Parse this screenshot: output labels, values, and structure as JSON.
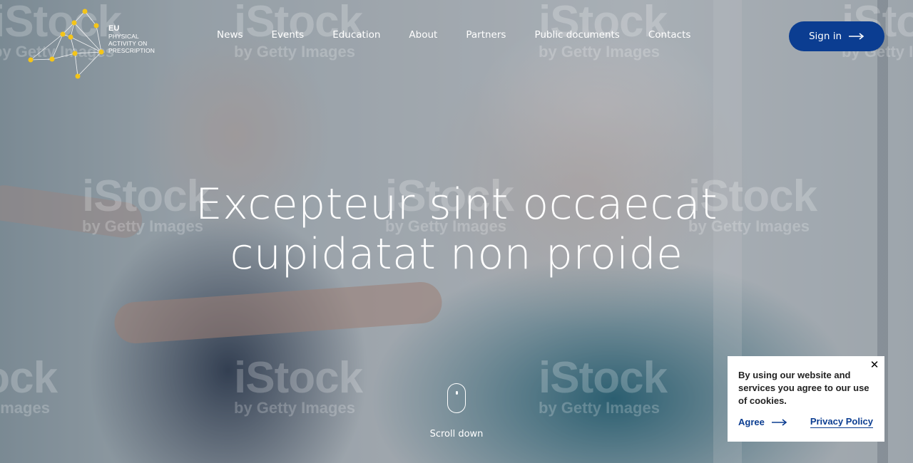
{
  "logo": {
    "line1": "EU",
    "line2": "PHYSICAL",
    "line3": "ACTIVITY ON",
    "line4": "PRESCRIPTION",
    "icon": "network-nodes-icon"
  },
  "nav": {
    "items": [
      {
        "label": "News"
      },
      {
        "label": "Events"
      },
      {
        "label": "Education"
      },
      {
        "label": "About"
      },
      {
        "label": "Partners"
      },
      {
        "label": "Public documents"
      },
      {
        "label": "Contacts"
      }
    ]
  },
  "signin": {
    "label": "Sign in",
    "icon": "arrow-right-icon",
    "color": "#0b3d91"
  },
  "hero": {
    "title_line1": "Excepteur sint occaecat",
    "title_line2": "cupidatat non proide",
    "watermark_big": "iStock",
    "watermark_small": "by Getty Images"
  },
  "scroll": {
    "label": "Scroll down",
    "icon": "mouse-icon"
  },
  "cookie": {
    "text": "By using our website and services you agree to our use of cookies.",
    "agree_label": "Agree",
    "privacy_label": "Privacy Policy",
    "close_icon": "close-icon"
  },
  "colors": {
    "accent": "#0b3d91",
    "logo_nodes": "#f5c518"
  }
}
